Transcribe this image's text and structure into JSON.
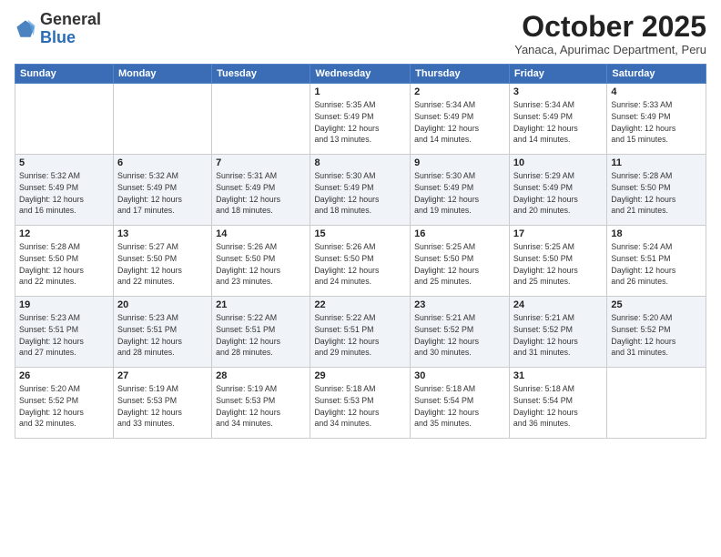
{
  "logo": {
    "general": "General",
    "blue": "Blue"
  },
  "header": {
    "month": "October 2025",
    "location": "Yanaca, Apurimac Department, Peru"
  },
  "weekdays": [
    "Sunday",
    "Monday",
    "Tuesday",
    "Wednesday",
    "Thursday",
    "Friday",
    "Saturday"
  ],
  "weeks": [
    [
      {
        "day": "",
        "info": ""
      },
      {
        "day": "",
        "info": ""
      },
      {
        "day": "",
        "info": ""
      },
      {
        "day": "1",
        "info": "Sunrise: 5:35 AM\nSunset: 5:49 PM\nDaylight: 12 hours\nand 13 minutes."
      },
      {
        "day": "2",
        "info": "Sunrise: 5:34 AM\nSunset: 5:49 PM\nDaylight: 12 hours\nand 14 minutes."
      },
      {
        "day": "3",
        "info": "Sunrise: 5:34 AM\nSunset: 5:49 PM\nDaylight: 12 hours\nand 14 minutes."
      },
      {
        "day": "4",
        "info": "Sunrise: 5:33 AM\nSunset: 5:49 PM\nDaylight: 12 hours\nand 15 minutes."
      }
    ],
    [
      {
        "day": "5",
        "info": "Sunrise: 5:32 AM\nSunset: 5:49 PM\nDaylight: 12 hours\nand 16 minutes."
      },
      {
        "day": "6",
        "info": "Sunrise: 5:32 AM\nSunset: 5:49 PM\nDaylight: 12 hours\nand 17 minutes."
      },
      {
        "day": "7",
        "info": "Sunrise: 5:31 AM\nSunset: 5:49 PM\nDaylight: 12 hours\nand 18 minutes."
      },
      {
        "day": "8",
        "info": "Sunrise: 5:30 AM\nSunset: 5:49 PM\nDaylight: 12 hours\nand 18 minutes."
      },
      {
        "day": "9",
        "info": "Sunrise: 5:30 AM\nSunset: 5:49 PM\nDaylight: 12 hours\nand 19 minutes."
      },
      {
        "day": "10",
        "info": "Sunrise: 5:29 AM\nSunset: 5:49 PM\nDaylight: 12 hours\nand 20 minutes."
      },
      {
        "day": "11",
        "info": "Sunrise: 5:28 AM\nSunset: 5:50 PM\nDaylight: 12 hours\nand 21 minutes."
      }
    ],
    [
      {
        "day": "12",
        "info": "Sunrise: 5:28 AM\nSunset: 5:50 PM\nDaylight: 12 hours\nand 22 minutes."
      },
      {
        "day": "13",
        "info": "Sunrise: 5:27 AM\nSunset: 5:50 PM\nDaylight: 12 hours\nand 22 minutes."
      },
      {
        "day": "14",
        "info": "Sunrise: 5:26 AM\nSunset: 5:50 PM\nDaylight: 12 hours\nand 23 minutes."
      },
      {
        "day": "15",
        "info": "Sunrise: 5:26 AM\nSunset: 5:50 PM\nDaylight: 12 hours\nand 24 minutes."
      },
      {
        "day": "16",
        "info": "Sunrise: 5:25 AM\nSunset: 5:50 PM\nDaylight: 12 hours\nand 25 minutes."
      },
      {
        "day": "17",
        "info": "Sunrise: 5:25 AM\nSunset: 5:50 PM\nDaylight: 12 hours\nand 25 minutes."
      },
      {
        "day": "18",
        "info": "Sunrise: 5:24 AM\nSunset: 5:51 PM\nDaylight: 12 hours\nand 26 minutes."
      }
    ],
    [
      {
        "day": "19",
        "info": "Sunrise: 5:23 AM\nSunset: 5:51 PM\nDaylight: 12 hours\nand 27 minutes."
      },
      {
        "day": "20",
        "info": "Sunrise: 5:23 AM\nSunset: 5:51 PM\nDaylight: 12 hours\nand 28 minutes."
      },
      {
        "day": "21",
        "info": "Sunrise: 5:22 AM\nSunset: 5:51 PM\nDaylight: 12 hours\nand 28 minutes."
      },
      {
        "day": "22",
        "info": "Sunrise: 5:22 AM\nSunset: 5:51 PM\nDaylight: 12 hours\nand 29 minutes."
      },
      {
        "day": "23",
        "info": "Sunrise: 5:21 AM\nSunset: 5:52 PM\nDaylight: 12 hours\nand 30 minutes."
      },
      {
        "day": "24",
        "info": "Sunrise: 5:21 AM\nSunset: 5:52 PM\nDaylight: 12 hours\nand 31 minutes."
      },
      {
        "day": "25",
        "info": "Sunrise: 5:20 AM\nSunset: 5:52 PM\nDaylight: 12 hours\nand 31 minutes."
      }
    ],
    [
      {
        "day": "26",
        "info": "Sunrise: 5:20 AM\nSunset: 5:52 PM\nDaylight: 12 hours\nand 32 minutes."
      },
      {
        "day": "27",
        "info": "Sunrise: 5:19 AM\nSunset: 5:53 PM\nDaylight: 12 hours\nand 33 minutes."
      },
      {
        "day": "28",
        "info": "Sunrise: 5:19 AM\nSunset: 5:53 PM\nDaylight: 12 hours\nand 34 minutes."
      },
      {
        "day": "29",
        "info": "Sunrise: 5:18 AM\nSunset: 5:53 PM\nDaylight: 12 hours\nand 34 minutes."
      },
      {
        "day": "30",
        "info": "Sunrise: 5:18 AM\nSunset: 5:54 PM\nDaylight: 12 hours\nand 35 minutes."
      },
      {
        "day": "31",
        "info": "Sunrise: 5:18 AM\nSunset: 5:54 PM\nDaylight: 12 hours\nand 36 minutes."
      },
      {
        "day": "",
        "info": ""
      }
    ]
  ]
}
